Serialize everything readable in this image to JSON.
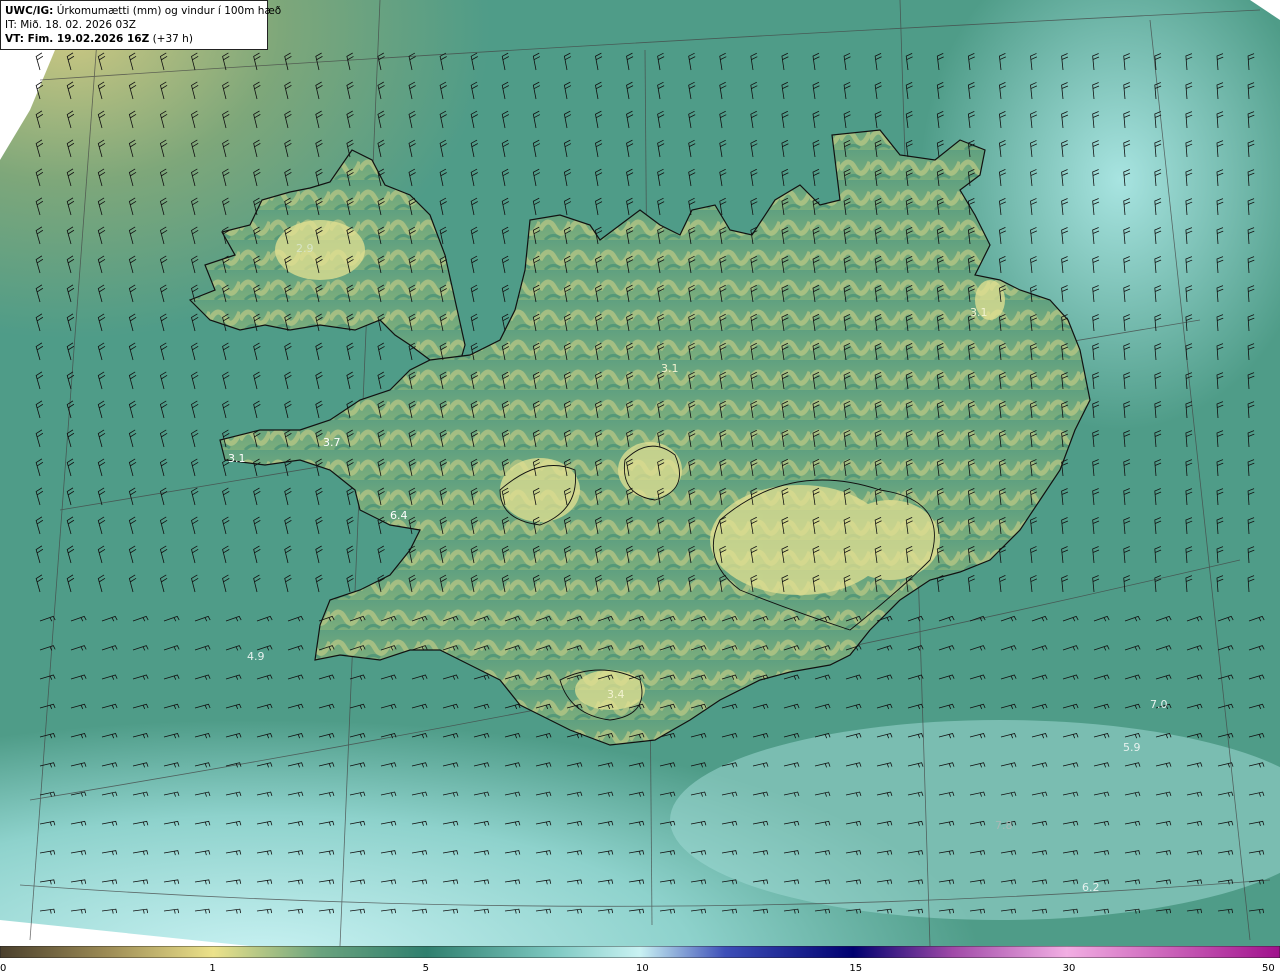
{
  "header": {
    "model_prefix": "UWC/IG:",
    "title": "Úrkomumætti (mm) og vindur í 100m hæð",
    "issue_time": "IT: Mið. 18. 02. 2026 03Z",
    "valid_prefix": "VT: Fim. 19.02.2026 16Z",
    "valid_suffix": "(+37 h)"
  },
  "colorbar": {
    "ticks": [
      "0",
      "1",
      "5",
      "10",
      "15",
      "30",
      "50"
    ],
    "stops": [
      {
        "v": 0,
        "color": "#4a3f2c"
      },
      {
        "v": 0.5,
        "color": "#9c8b55"
      },
      {
        "v": 1,
        "color": "#ece28a"
      },
      {
        "v": 3,
        "color": "#6aa37e"
      },
      {
        "v": 5,
        "color": "#2f7f6e"
      },
      {
        "v": 8,
        "color": "#7ec9c2"
      },
      {
        "v": 10,
        "color": "#c9f2f3"
      },
      {
        "v": 12,
        "color": "#3d4fb8"
      },
      {
        "v": 15,
        "color": "#000070"
      },
      {
        "v": 22,
        "color": "#a04aa8"
      },
      {
        "v": 30,
        "color": "#f2aee3"
      },
      {
        "v": 50,
        "color": "#a0108c"
      }
    ]
  },
  "values": [
    {
      "name": "value-label-2-9-westfjords",
      "text": "2.9",
      "color": "#d8e6c8"
    },
    {
      "name": "value-label-3-7-snaefellsnes",
      "text": "3.7",
      "color": "#ffffff"
    },
    {
      "name": "value-label-3-1-west-tip",
      "text": "3.1",
      "color": "#ffffff"
    },
    {
      "name": "value-label-6-4-faxafloi",
      "text": "6.4",
      "color": "#ffffff"
    },
    {
      "name": "value-label-3-1-north",
      "text": "3.1",
      "color": "#f3f3d0"
    },
    {
      "name": "value-label-3-1-east",
      "text": "3.1",
      "color": "#f3f3d0"
    },
    {
      "name": "value-label-4-9-southwest-sea",
      "text": "4.9",
      "color": "#e6f1ee"
    },
    {
      "name": "value-label-3-4-south",
      "text": "3.4",
      "color": "#f3f3d0"
    },
    {
      "name": "value-label-7-0-southeast-sea",
      "text": "7.0",
      "color": "#e6f1ee"
    },
    {
      "name": "value-label-5-9-southeast-sea",
      "text": "5.9",
      "color": "#e6f1ee"
    },
    {
      "name": "value-label-7-8-south-sea",
      "text": "7.8",
      "color": "#a8b8b4"
    },
    {
      "name": "value-label-6-2-south-sea",
      "text": "6.2",
      "color": "#e6f1ee"
    }
  ],
  "colors": {
    "sea_dark": "#3f8a78",
    "sea_mid": "#5da596",
    "sea_light": "#9fdcd8",
    "land_green": "#6aa37e",
    "land_yellow": "#d6d68a",
    "coast": "#111111",
    "barb": "#111111"
  }
}
